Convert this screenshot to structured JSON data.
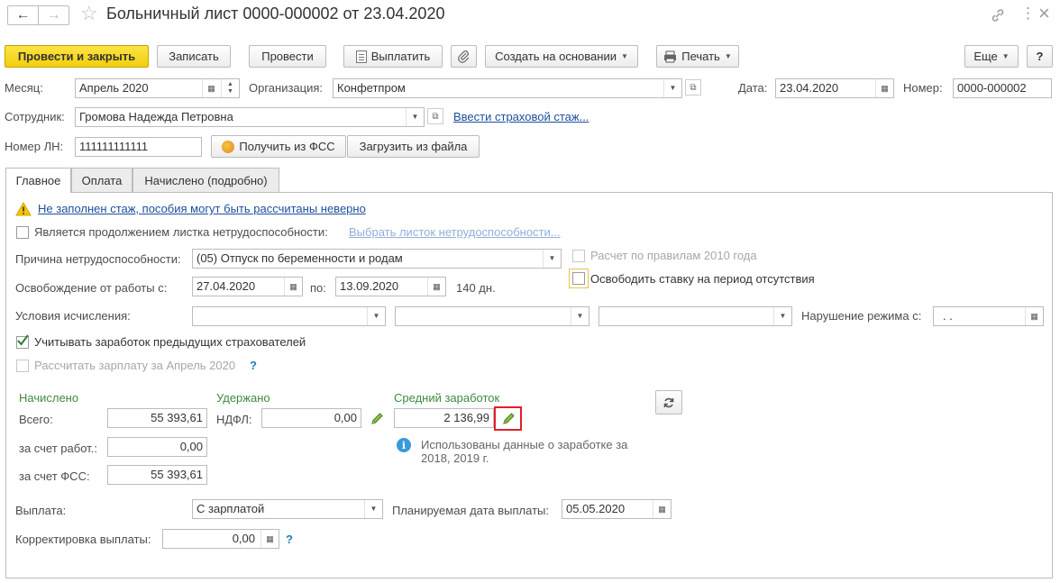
{
  "window": {
    "title": "Больничный лист 0000-000002 от 23.04.2020",
    "back_icon": "←",
    "forward_icon": "→",
    "star_icon": "☆",
    "more_icon": "⋮",
    "close_icon": "×"
  },
  "toolbar": {
    "post_close": "Провести и закрыть",
    "save": "Записать",
    "post": "Провести",
    "pay": "Выплатить",
    "create_based": "Создать на основании",
    "print": "Печать",
    "more": "Еще",
    "help": "?"
  },
  "header": {
    "month_label": "Месяц:",
    "month_value": "Апрель 2020",
    "org_label": "Организация:",
    "org_value": "Конфетпром",
    "date_label": "Дата:",
    "date_value": "23.04.2020",
    "number_label": "Номер:",
    "number_value": "0000-000002",
    "employee_label": "Сотрудник:",
    "employee_value": "Громова Надежда Петровна",
    "insurance_link": "Ввести страховой стаж...",
    "ln_label": "Номер ЛН:",
    "ln_value": "111111111111",
    "get_fss": "Получить из ФСС",
    "load_file": "Загрузить из файла"
  },
  "tabs": [
    {
      "label": "Главное"
    },
    {
      "label": "Оплата"
    },
    {
      "label": "Начислено (подробно)"
    }
  ],
  "main": {
    "warning_link": "Не заполнен стаж, пособия могут быть рассчитаны неверно",
    "continuation_label": "Является продолжением листка нетрудоспособности:",
    "choose_sheet_link": "Выбрать листок нетрудоспособности...",
    "reason_label": "Причина нетрудоспособности:",
    "reason_value": "(05) Отпуск по беременности и родам",
    "rules2010_label": "Расчет по правилам 2010 года",
    "free_rate_label": "Освободить ставку на период отсутствия",
    "release_label": "Освобождение от работы с:",
    "release_from": "27.04.2020",
    "to_label": "по:",
    "release_to": "13.09.2020",
    "days": "140 дн.",
    "conditions_label": "Условия исчисления:",
    "violation_label": "Нарушение режима с:",
    "violation_value": " .  .",
    "prev_insurers_label": "Учитывать заработок предыдущих страхователей",
    "calc_salary_label": "Рассчитать зарплату за Апрель 2020",
    "question": "?"
  },
  "accrued": {
    "title": "Начислено",
    "total_label": "Всего:",
    "total_value": "55 393,61",
    "employer_label": "за счет работ.:",
    "employer_value": "0,00",
    "fss_label": "за счет ФСС:",
    "fss_value": "55 393,61"
  },
  "withheld": {
    "title": "Удержано",
    "ndfl_label": "НДФЛ:",
    "ndfl_value": "0,00"
  },
  "average": {
    "title": "Средний заработок",
    "value": "2 136,99",
    "info": "Использованы данные о заработке за 2018,  2019 г."
  },
  "payment": {
    "payout_label": "Выплата:",
    "payout_value": "С зарплатой",
    "planned_label": "Планируемая дата выплаты:",
    "planned_value": "05.05.2020",
    "correction_label": "Корректировка выплаты:",
    "correction_value": "0,00",
    "question": "?"
  },
  "colors": {
    "primary_button": "#f3cf0c",
    "link": "#1b4f9c",
    "group_title": "#3f8a3f",
    "highlight": "#e0202a"
  }
}
